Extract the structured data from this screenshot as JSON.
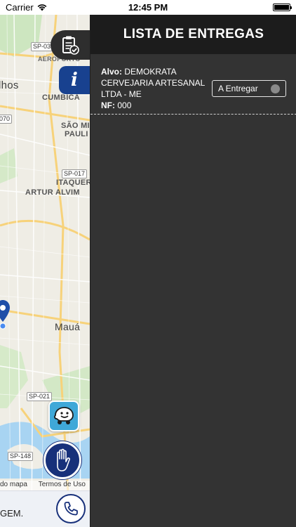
{
  "status_bar": {
    "carrier": "Carrier",
    "time": "12:45 PM"
  },
  "map": {
    "labels": {
      "lhos": "lhos",
      "aeroporto": "AEROPORTO",
      "cumbica": "CUMBICA",
      "sao_miguel": "SÃO MI",
      "paulista": "PAULI",
      "itaquera": "ITAQUER",
      "artur_alvim": "ARTUR ALVIM",
      "maua": "Mauá"
    },
    "shields": {
      "sp03": "SP-03",
      "r070": "070",
      "sp017": "SP-017",
      "sp021": "SP-021",
      "sp148": "SP-148"
    },
    "footer": {
      "map_data": "do mapa",
      "terms": "Termos de Uso"
    }
  },
  "bottom_bar": {
    "text": "GEM."
  },
  "icons": {
    "tab": "clipboard-check-icon",
    "info": "i",
    "waze": "waze-icon",
    "hand": "hand-stop-icon",
    "phone": "phone-icon"
  },
  "colors": {
    "panel_bg": "#333333",
    "header_bg": "#1c1c1c",
    "info_blue": "#18418f",
    "pin_blue": "#1f4fa8"
  },
  "panel": {
    "title": "LISTA DE ENTREGAS",
    "deliveries": [
      {
        "target_label": "Alvo:",
        "target": "DEMOKRATA CERVEJARIA ARTESANAL LTDA - ME",
        "nf_label": "NF:",
        "nf": "000",
        "status": "A Entregar"
      }
    ]
  }
}
